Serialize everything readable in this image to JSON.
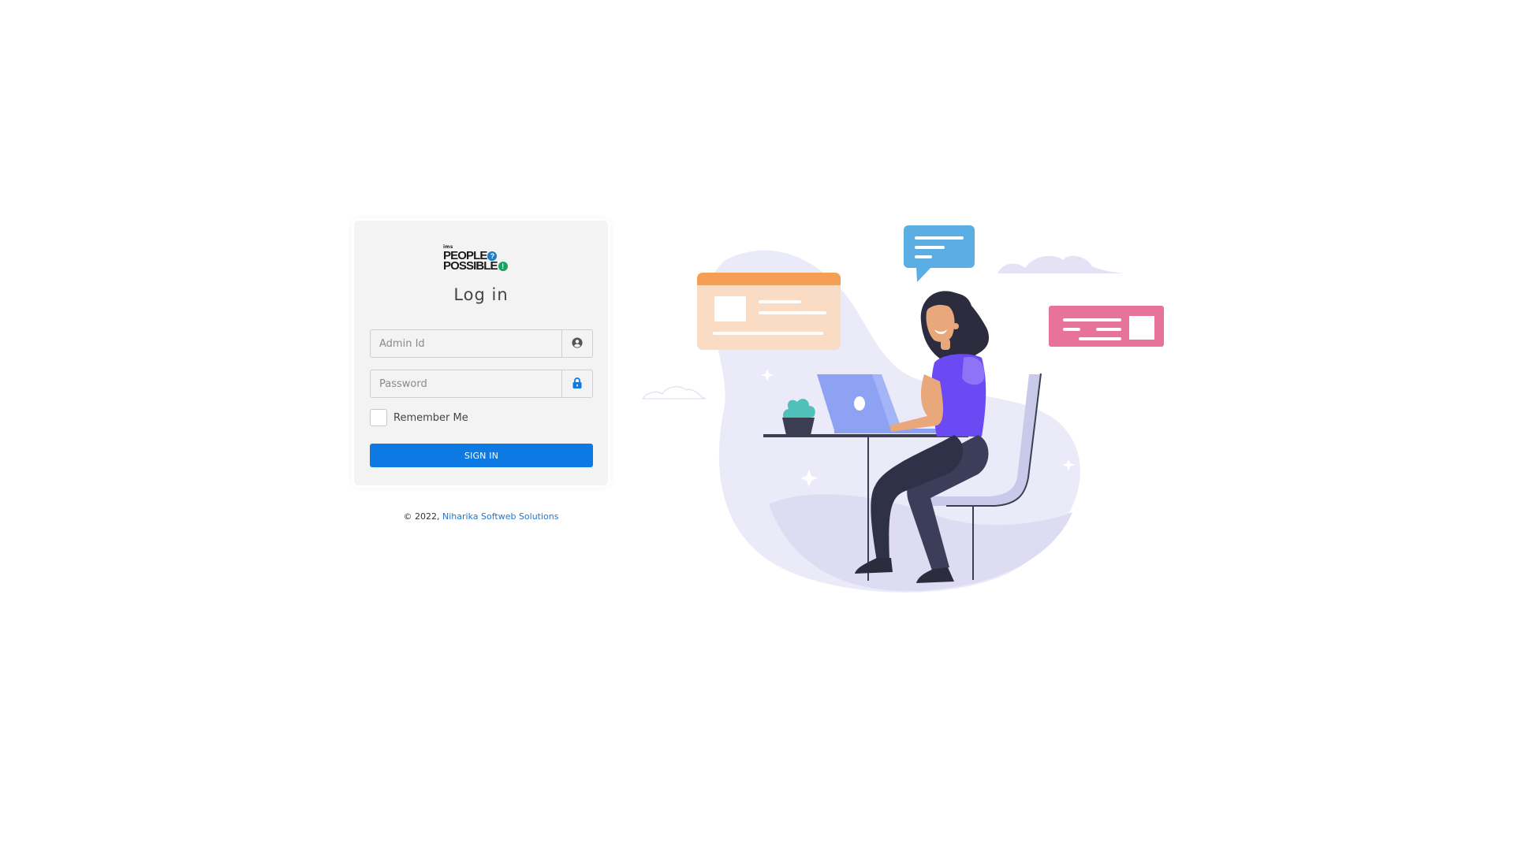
{
  "login": {
    "logo_ims": "ims",
    "logo_line1": "PEOPLE",
    "logo_line2": "POSSIBLE",
    "logo_q_mark": "?",
    "logo_excl_mark": "!",
    "title": "Log in",
    "admin_id_placeholder": "Admin Id",
    "password_placeholder": "Password",
    "remember_label": "Remember Me",
    "remember_checked": false,
    "signin_label": "SIGN IN"
  },
  "footer": {
    "copyright": "© 2022,",
    "company_link": "Niharika Softweb Solutions"
  },
  "icons": {
    "user": "user-circle-icon",
    "lock": "lock-icon"
  },
  "colors": {
    "primary": "#0d7ae3",
    "link": "#1d76d2",
    "card_bg": "#f3f3f3"
  }
}
